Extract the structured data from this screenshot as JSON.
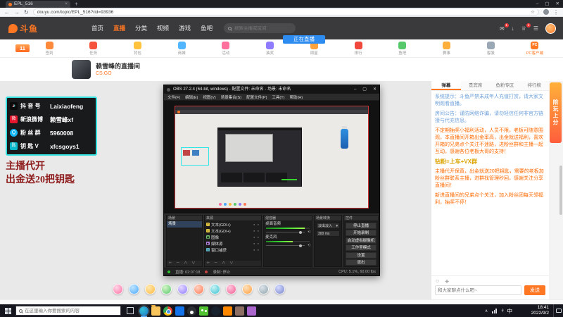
{
  "colors": {
    "douyu_orange": "#ff7723",
    "contact_panel_border_cyan": "#35e0e0",
    "promo_text_red": "#8f1d1d",
    "announcement_orange": "#ff6a00",
    "vip_gold": "#dba400",
    "obs_meter_green": "#38d430",
    "live_button_blue": "#2e8cf0"
  },
  "browser": {
    "tab_title": "EPL_516",
    "url": "douyu.com/topic/EPL_516?rid=93936"
  },
  "header": {
    "logo": "斗鱼",
    "nav": [
      "首页",
      "直播",
      "分类",
      "视频",
      "游戏",
      "鱼吧"
    ],
    "search_placeholder": "搜索主播或房间",
    "live_button": "正在直播",
    "badge": "1"
  },
  "activity_bar": {
    "level": "11",
    "items": [
      "签到",
      "任务",
      "背包",
      "商城",
      "活动",
      "抽奖",
      "周星",
      "排行",
      "鱼吧",
      "赛事",
      "客服",
      "PC客户端"
    ]
  },
  "room": {
    "title": "赖雪峰的直播间",
    "category": "CS:GO"
  },
  "overlay": {
    "contacts": [
      {
        "label": "抖 音 号",
        "value": "Laixiaofeng"
      },
      {
        "label": "新浪微博",
        "value": "赖雪峰xf"
      },
      {
        "label": "粉 丝 群",
        "value": "5960008"
      },
      {
        "label": "钥 匙 V",
        "value": "xfcsgoys1"
      }
    ],
    "promo_line1": "主播代开",
    "promo_line2": "出金送20把钥匙"
  },
  "obs": {
    "title": "OBS 27.2.4 (64-bit, windows) - 配置文件: 未命名 - 场景: 未命名",
    "menu": [
      "文件(F)",
      "编辑(E)",
      "视图(V)",
      "场景集合(S)",
      "配置文件(P)",
      "工具(T)",
      "帮助(H)"
    ],
    "docks": {
      "scenes": {
        "title": "场景",
        "items": [
          "场景"
        ]
      },
      "sources": {
        "title": "来源",
        "items": [
          "文本(GDI+)",
          "文本(GDI+)",
          "图像",
          "媒体源",
          "窗口捕获"
        ]
      },
      "mixer": {
        "title": "混音器",
        "channels": [
          "桌面音频",
          "麦克风"
        ]
      },
      "transitions": {
        "title": "场景转换",
        "selected": "淡出淡入",
        "duration": "300 ms"
      },
      "controls": {
        "title": "控件",
        "buttons": [
          "停止直播",
          "开始录制",
          "启动虚拟摄像机",
          "工作室模式",
          "设置",
          "退出"
        ]
      }
    },
    "status": {
      "live": "直播: 02:07:18",
      "rec": "录制: 停止",
      "cpu": "CPU: 5.1%, 60.00 fps"
    }
  },
  "chat": {
    "tabs": [
      "弹幕",
      "贵宾席",
      "鱼粉专区",
      "排行榜"
    ],
    "messages": [
      {
        "color": "blue",
        "text": "系统提示：斗鱼严禁未成年人充值打赏，请大家文明观看直播。"
      },
      {
        "color": "blue",
        "text": "房间公告：谨防网络诈骗，请勿轻信任何非官方链接与代充信息。"
      },
      {
        "color": "orange",
        "text": "不定期抽奖小福利活动，人员不限，老板可随意围观，本直播间开箱出金率高，出金就送福利，喜欢开箱的兄弟点个关注不迷路，进粉丝群和主播一起互动，感谢各位老板大哥的支持！"
      },
      {
        "color": "gold",
        "text": "钻粉=上车+VX群"
      },
      {
        "color": "orange",
        "text": "主播代开保真，出金就送20把钥匙，需要的老板加粉丝群联系主播，进群找管理秒回，感谢关注分享直播间！"
      },
      {
        "color": "orange",
        "text": "新进直播间的兄弟点个关注，加入粉丝团每天领福利，抽奖不停！"
      }
    ],
    "input_placeholder": "和大家聊点什么吧~",
    "send_label": "发送"
  },
  "banner": {
    "text": "陪玩上分"
  },
  "taskbar": {
    "search_placeholder": "在这里输入你要搜索的内容",
    "ime": "中",
    "time": "18:41",
    "date": "2022/9/2"
  },
  "icons": {
    "min": "–",
    "max": "▢",
    "close": "✕",
    "tab_close": "×",
    "new_tab": "+",
    "back": "←",
    "forward": "→",
    "reload": "↻",
    "star": "☆",
    "menu": "⋮",
    "message": "✉",
    "download": "↓",
    "crown": "♕",
    "list": "☰",
    "douyin": "♪",
    "weibo": "微",
    "qq": "Q",
    "key": "匙",
    "pc": "PC",
    "plus_minus_updown": "＋ － ∧ ∨",
    "caret_down": "▾",
    "caret_up": "∧",
    "text_source": "T",
    "image_source": "▣",
    "media_source": "▶",
    "window_source": "▢",
    "source_meta": "● ●",
    "speaker": "◖)",
    "smiley": "☺",
    "settings": "✚"
  }
}
